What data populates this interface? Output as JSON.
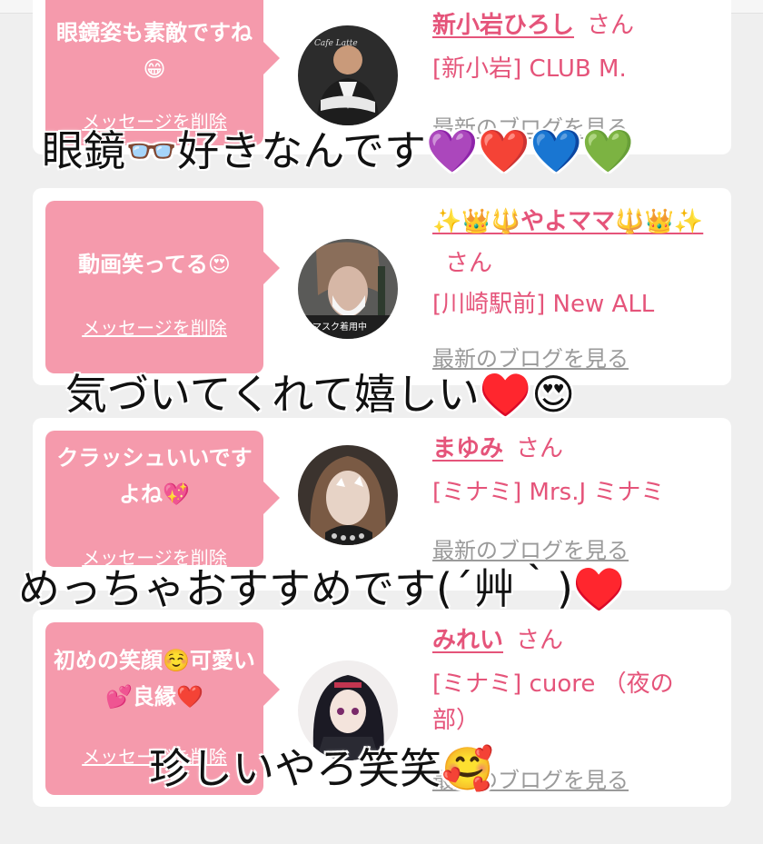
{
  "messages": [
    {
      "comment": "眼鏡姿も素敵ですね😁",
      "delete_label": "メッセージを削除",
      "name": "新小岩ひろし",
      "honorific": "さん",
      "shop": "[新小岩] CLUB M.",
      "blog_label": "最新のブログを見る"
    },
    {
      "comment": "動画笑ってる😍",
      "delete_label": "メッセージを削除",
      "name": "✨👑🔱やよママ🔱👑✨",
      "honorific": "さん",
      "shop": "[川崎駅前] New ALL",
      "blog_label": "最新のブログを見る",
      "avatar_text": "マスク着用中"
    },
    {
      "comment": "クラッシュいいですよね💖",
      "delete_label": "メッセージを削除",
      "name": "まゆみ",
      "honorific": "さん",
      "shop": "[ミナミ] Mrs.J ミナミ",
      "blog_label": "最新のブログを見る"
    },
    {
      "comment": "初めの笑顔☺️可愛い💕良縁❤️",
      "delete_label": "メッセージを削除",
      "name": "みれい",
      "honorific": "さん",
      "shop": "[ミナミ] cuore （夜の部）",
      "blog_label": "最新のブログを見る"
    }
  ],
  "captions": [
    "眼鏡👓好きなんです💜❤️💙💚",
    "気づいてくれて嬉しい♥️😍",
    "めっちゃおすすめです(´艸｀)♥️",
    "珍しいやろ笑笑🥰"
  ],
  "colors": {
    "accent": "#e5547a",
    "bubble": "#f59aac",
    "background": "#efefef"
  }
}
